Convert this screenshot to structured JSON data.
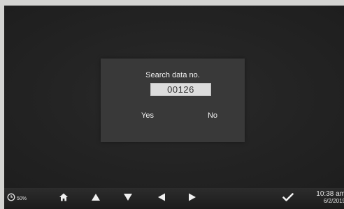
{
  "dialog": {
    "title": "Search data no.",
    "value": "00126",
    "yes_label": "Yes",
    "no_label": "No"
  },
  "toolbar": {
    "zoom": "50%",
    "icons": [
      "clock-icon",
      "home-icon",
      "arrow-up-icon",
      "arrow-down-icon",
      "arrow-left-icon",
      "arrow-right-icon",
      "checkmark-icon"
    ]
  },
  "status": {
    "time": "10:38 am",
    "date": "6/2/2019"
  },
  "colors": {
    "background": "#222222",
    "dialog": "#393939",
    "field": "#dcdcdc",
    "text": "#f2f2f2"
  }
}
